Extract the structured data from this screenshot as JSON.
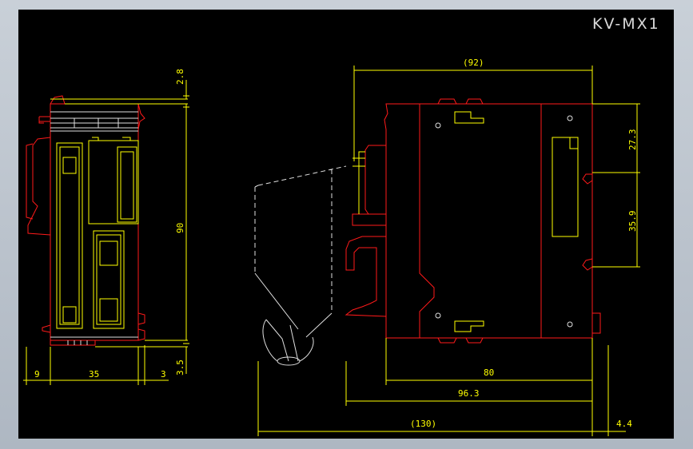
{
  "drawing": {
    "title": "KV-MX1",
    "colors": {
      "background": "#000000",
      "outline": "#ff1a1a",
      "dimension": "#ffff00",
      "component": "#ffff00",
      "hole": "#ffffff"
    }
  },
  "front_view": {
    "dimensions": {
      "top_gap": "2.8",
      "height": "90",
      "bottom_gap": "3.5",
      "left_width": "9",
      "body_width": "35",
      "right_width": "3"
    }
  },
  "side_view": {
    "dimensions": {
      "top_width": "(92)",
      "upper_rail": "27.3",
      "rail_span": "35.9",
      "body_depth": "80",
      "mount_depth": "96.3",
      "total_depth": "(130)",
      "rail_offset": "4.4"
    }
  }
}
